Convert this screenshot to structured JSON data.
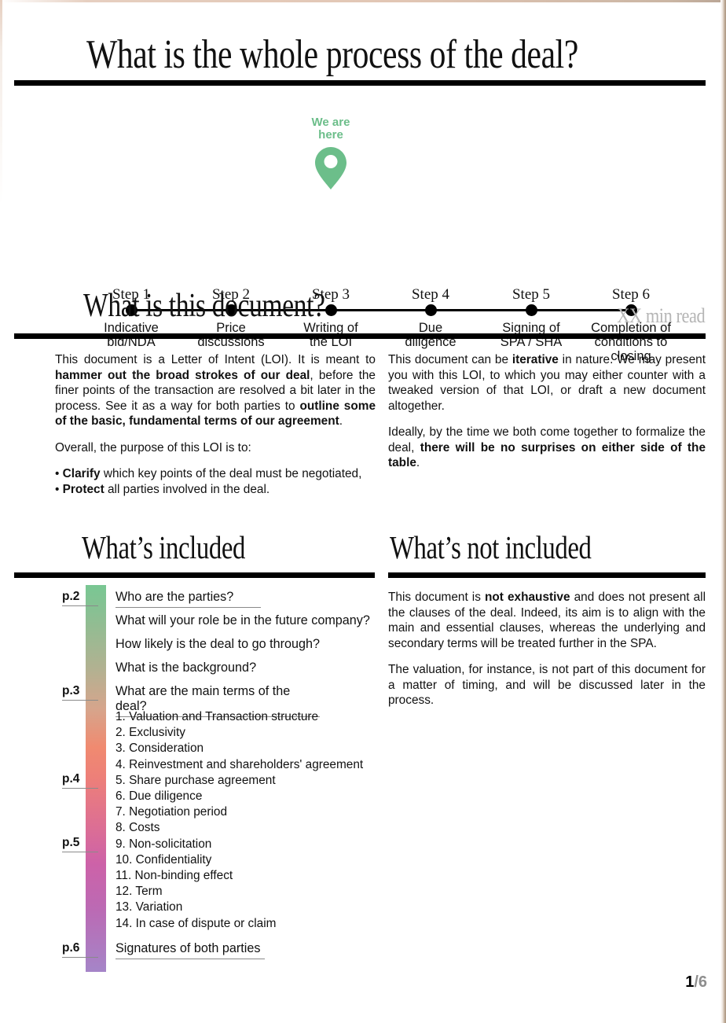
{
  "header": {
    "title": "What is the whole process of the deal?"
  },
  "timeline": {
    "marker": {
      "label_line1": "We are",
      "label_line2": "here",
      "color": "#6cbe8a",
      "at_step": 3,
      "icon": "map-pin-icon"
    },
    "steps": [
      {
        "label": "Step 1",
        "desc": "Indicative\nbid/NDA",
        "desc_lines": [
          "Indicative",
          "bid/NDA"
        ]
      },
      {
        "label": "Step 2",
        "desc_lines": [
          "Price",
          "discussions"
        ]
      },
      {
        "label": "Step 3",
        "desc_lines": [
          "Writing of",
          "the LOI"
        ]
      },
      {
        "label": "Step 4",
        "desc_lines": [
          "Due",
          "diligence"
        ]
      },
      {
        "label": "Step 5",
        "desc_lines": [
          "Signing of",
          "SPA / SHA"
        ]
      },
      {
        "label": "Step 6",
        "desc_lines": [
          "Completion of",
          "conditions to",
          "closing"
        ]
      }
    ]
  },
  "document_section": {
    "title": "What is this document?",
    "read_time": "XX min read",
    "left_column": {
      "para1_part1": "This document is a Letter of Intent (LOI). It is meant to ",
      "para1_bold1": "hammer out the broad strokes of our deal",
      "para1_part2": ", before the finer points of the transaction are resolved a bit later in the process. See it as a way for both parties to ",
      "para1_bold2": "outline some of the basic, fundamental terms of our agreement",
      "para1_part3": ".",
      "para2": "Overall, the purpose of this LOI is to:",
      "bullet1_bold": "Clarify",
      "bullet1_rest": " which key points of the deal must be negotiated,",
      "bullet2_bold": "Protect",
      "bullet2_rest": " all parties involved in the deal.",
      "bullet_marker": "• "
    },
    "right_column": {
      "para1_part1": "This document can be ",
      "para1_bold1": "iterative",
      "para1_part2": " in nature. We may present you with this LOI, to which you may either counter with a tweaked version of that LOI, or draft a new document altogether.",
      "para2_part1": "Ideally, by the time we both come together to formalize the deal, ",
      "para2_bold1": "there will be no surprises on either side of the table",
      "para2_part2": "."
    }
  },
  "included_section": {
    "title": "What’s included",
    "toc": [
      {
        "page": "p.2",
        "text": "Who are the parties?",
        "ruled": true
      },
      {
        "page": "",
        "text": "What will your role be in the future company?",
        "ruled": false
      },
      {
        "page": "",
        "text": "How likely is the deal to go through?",
        "ruled": false
      },
      {
        "page": "",
        "text": "What is the background?",
        "ruled": false
      },
      {
        "page": "p.3",
        "text": "What are the main terms of the deal?",
        "ruled": true
      }
    ],
    "subitems": [
      "1. Valuation and Transaction structure",
      "2. Exclusivity",
      "3. Consideration",
      "4. Reinvestment and shareholders' agreement",
      "5. Share purchase agreement",
      "6. Due diligence",
      "7. Negotiation period",
      "8. Costs",
      "9. Non-solicitation",
      "10. Confidentiality",
      "11. Non-binding effect",
      "12. Term",
      "13. Variation",
      "14. In case of dispute or claim"
    ],
    "sub_page_markers": [
      {
        "page": "p.4",
        "at_index": 4
      },
      {
        "page": "p.5",
        "at_index": 8
      }
    ],
    "final": {
      "page": "p.6",
      "text": "Signatures of both parties",
      "ruled": true
    },
    "gradient_colors": [
      "#79c793",
      "#b3b191",
      "#f08a70",
      "#dd6f93",
      "#a585c8"
    ]
  },
  "not_included_section": {
    "title": "What’s not included",
    "para1_part1": "This document is ",
    "para1_bold1": "not exhaustive",
    "para1_part2": " and does not present all the clauses of the deal. Indeed, its aim is to align with the main and essential clauses, whereas the underlying and secondary terms will be treated further in the SPA.",
    "para2": "The valuation, for instance, is not part of this document for a matter of timing, and will be discussed later in the process."
  },
  "footer": {
    "current_page": "1",
    "total_pages": "/6"
  }
}
